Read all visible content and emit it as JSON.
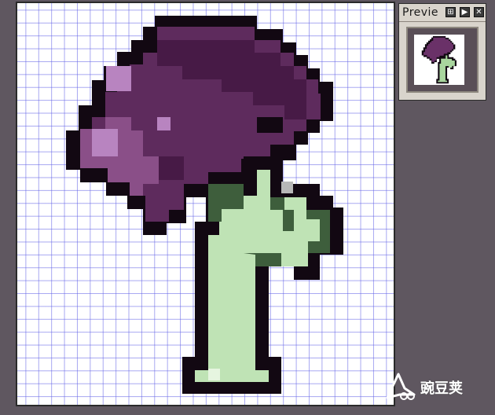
{
  "preview_panel": {
    "title": "Previe",
    "buttons": [
      {
        "name": "zoom-button",
        "icon": "zoom-icon"
      },
      {
        "name": "play-button",
        "icon": "play-icon"
      },
      {
        "name": "close-button",
        "icon": "close-icon"
      }
    ]
  },
  "canvas": {
    "subject": "pixel-art-purple-mushroom-plant",
    "colors": {
      "outline": "#120812",
      "cap_dark": "#471a46",
      "cap_mid": "#5e2b5d",
      "cap_light": "#8a4f88",
      "cap_highlight": "#b884c0",
      "stem_light": "#bfe3b5",
      "stem_dark": "#3e5e3c",
      "grid": "#6060e6",
      "background": "#ffffff"
    }
  },
  "watermark": {
    "text": "豌豆荚"
  }
}
